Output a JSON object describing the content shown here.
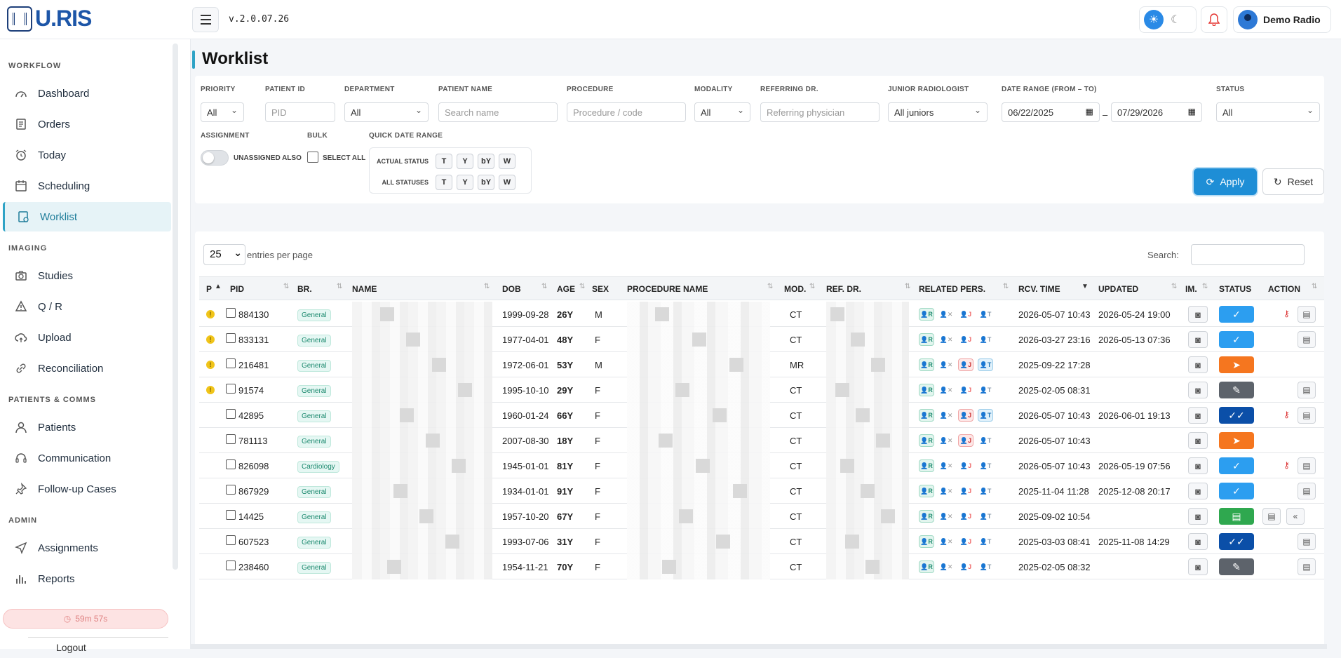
{
  "app": {
    "logo_text": "U.RIS",
    "version": "v.2.0.07.26",
    "user_name": "Demo Radio"
  },
  "sidebar": {
    "sections": [
      {
        "label": "WORKFLOW",
        "items": [
          "Dashboard",
          "Orders",
          "Today",
          "Scheduling",
          "Worklist"
        ]
      },
      {
        "label": "IMAGING",
        "items": [
          "Studies",
          "Q / R",
          "Upload",
          "Reconciliation"
        ]
      },
      {
        "label": "PATIENTS & COMMS",
        "items": [
          "Patients",
          "Communication",
          "Follow-up Cases"
        ]
      },
      {
        "label": "ADMIN",
        "items": [
          "Assignments",
          "Reports"
        ]
      }
    ],
    "active_item": "Worklist",
    "session_timer": "59m 57s",
    "logout_label": "Logout"
  },
  "page": {
    "title": "Worklist"
  },
  "filters": {
    "priority": {
      "label": "PRIORITY",
      "value": "All"
    },
    "patient_id": {
      "label": "PATIENT ID",
      "placeholder": "PID"
    },
    "department": {
      "label": "DEPARTMENT",
      "value": "All"
    },
    "patient_name": {
      "label": "PATIENT NAME",
      "placeholder": "Search name"
    },
    "procedure": {
      "label": "PROCEDURE",
      "placeholder": "Procedure / code"
    },
    "modality": {
      "label": "MODALITY",
      "value": "All"
    },
    "referring": {
      "label": "REFERRING DR.",
      "placeholder": "Referring physician"
    },
    "junior": {
      "label": "JUNIOR RADIOLOGIST",
      "value": "All juniors"
    },
    "date_range": {
      "label": "DATE RANGE (FROM – TO)",
      "from": "06/22/2025",
      "separator": "–",
      "to": "07/29/2026"
    },
    "status": {
      "label": "STATUS",
      "value": "All"
    },
    "assignment": {
      "label": "ASSIGNMENT",
      "toggle_label": "UNASSIGNED ALSO"
    },
    "bulk": {
      "label": "BULK",
      "select_all_label": "SELECT ALL"
    },
    "quick_date": {
      "label": "QUICK DATE RANGE",
      "rows": [
        {
          "label": "ACTUAL STATUS",
          "buttons": [
            "T",
            "Y",
            "bY",
            "W"
          ]
        },
        {
          "label": "ALL STATUSES",
          "buttons": [
            "T",
            "Y",
            "bY",
            "W"
          ]
        }
      ]
    },
    "apply_label": "Apply",
    "reset_label": "Reset"
  },
  "table": {
    "entries_value": "25",
    "entries_label": "entries per page",
    "search_label": "Search:",
    "columns": [
      "P",
      "PID",
      "BR.",
      "NAME",
      "DOB",
      "AGE",
      "SEX",
      "PROCEDURE NAME",
      "MOD.",
      "REF. DR.",
      "RELATED PERS.",
      "RCV. TIME",
      "UPDATED",
      "IM.",
      "STATUS",
      "ACTION"
    ],
    "rows": [
      {
        "prio": true,
        "pid": "884130",
        "branch": "General",
        "dob": "1999-09-28",
        "age": "26Y",
        "sex": "M",
        "mod": "CT",
        "rcv": "2026-05-07 10:43",
        "updated": "2026-05-24 19:00",
        "status": "check",
        "jf": false,
        "tf": false,
        "key": true,
        "acts": [
          "doc"
        ]
      },
      {
        "prio": true,
        "pid": "833131",
        "branch": "General",
        "dob": "1977-04-01",
        "age": "48Y",
        "sex": "F",
        "mod": "CT",
        "rcv": "2026-03-27 23:16",
        "updated": "2026-05-13 07:36",
        "status": "check",
        "jf": false,
        "tf": false,
        "key": false,
        "acts": [
          "doc"
        ]
      },
      {
        "prio": true,
        "pid": "216481",
        "branch": "General",
        "dob": "1972-06-01",
        "age": "53Y",
        "sex": "M",
        "mod": "MR",
        "rcv": "2025-09-22 17:28",
        "updated": "",
        "status": "send",
        "jf": true,
        "tf": true,
        "key": false,
        "acts": []
      },
      {
        "prio": true,
        "pid": "91574",
        "branch": "General",
        "dob": "1995-10-10",
        "age": "29Y",
        "sex": "F",
        "mod": "CT",
        "rcv": "2025-02-05 08:31",
        "updated": "",
        "status": "edit",
        "jf": false,
        "tf": false,
        "key": false,
        "acts": [
          "doc"
        ]
      },
      {
        "prio": false,
        "pid": "42895",
        "branch": "General",
        "dob": "1960-01-24",
        "age": "66Y",
        "sex": "F",
        "mod": "CT",
        "rcv": "2026-05-07 10:43",
        "updated": "2026-06-01 19:13",
        "status": "dcheck",
        "jf": true,
        "tf": true,
        "key": true,
        "acts": [
          "doc"
        ]
      },
      {
        "prio": false,
        "pid": "781113",
        "branch": "General",
        "dob": "2007-08-30",
        "age": "18Y",
        "sex": "F",
        "mod": "CT",
        "rcv": "2026-05-07 10:43",
        "updated": "",
        "status": "send",
        "jf": true,
        "tf": false,
        "key": false,
        "acts": []
      },
      {
        "prio": false,
        "pid": "826098",
        "branch": "Cardiology",
        "dob": "1945-01-01",
        "age": "81Y",
        "sex": "F",
        "mod": "CT",
        "rcv": "2026-05-07 10:43",
        "updated": "2026-05-19 07:56",
        "status": "check",
        "jf": false,
        "tf": false,
        "key": true,
        "acts": [
          "doc"
        ]
      },
      {
        "prio": false,
        "pid": "867929",
        "branch": "General",
        "dob": "1934-01-01",
        "age": "91Y",
        "sex": "F",
        "mod": "CT",
        "rcv": "2025-11-04 11:28",
        "updated": "2025-12-08 20:17",
        "status": "check",
        "jf": false,
        "tf": false,
        "key": false,
        "acts": [
          "doc"
        ]
      },
      {
        "prio": false,
        "pid": "14425",
        "branch": "General",
        "dob": "1957-10-20",
        "age": "67Y",
        "sex": "F",
        "mod": "CT",
        "rcv": "2025-09-02 10:54",
        "updated": "",
        "status": "report",
        "jf": false,
        "tf": false,
        "key": false,
        "acts": [
          "doc",
          "back"
        ]
      },
      {
        "prio": false,
        "pid": "607523",
        "branch": "General",
        "dob": "1993-07-06",
        "age": "31Y",
        "sex": "F",
        "mod": "CT",
        "rcv": "2025-03-03 08:41",
        "updated": "2025-11-08 14:29",
        "status": "dcheck",
        "jf": false,
        "tf": false,
        "key": false,
        "acts": [
          "doc"
        ]
      },
      {
        "prio": false,
        "pid": "238460",
        "branch": "General",
        "dob": "1954-11-21",
        "age": "70Y",
        "sex": "F",
        "mod": "CT",
        "rcv": "2025-02-05 08:32",
        "updated": "",
        "status": "edit",
        "jf": false,
        "tf": false,
        "key": false,
        "acts": [
          "doc"
        ]
      }
    ]
  },
  "colors": {
    "accent": "#2ea3c6",
    "primary": "#1e8ed6",
    "send": "#f5761f",
    "done": "#0b4fa8",
    "report": "#2fa84f"
  }
}
